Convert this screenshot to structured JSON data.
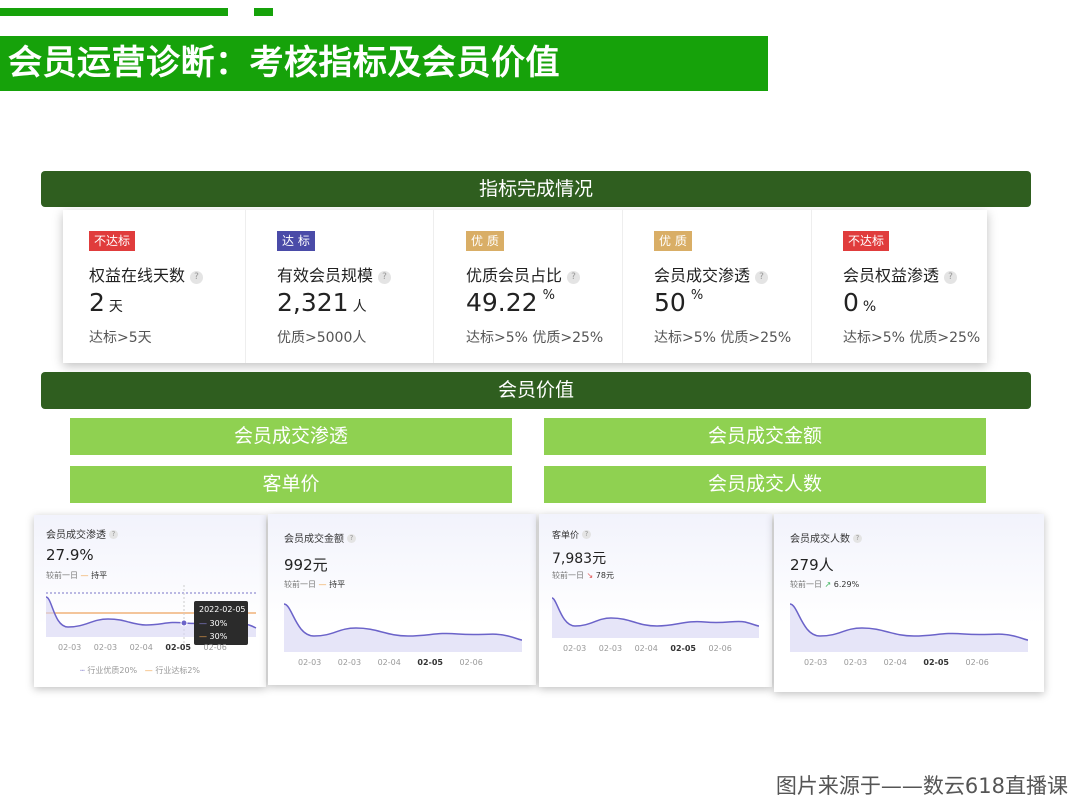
{
  "page_title": "会员运营诊断：考核指标及会员价值",
  "section_kpi": "指标完成情况",
  "section_value": "会员价值",
  "kpis": [
    {
      "badge": "不达标",
      "badge_color": "#e03c3c",
      "label": "权益在线天数",
      "help": "?",
      "value": "2",
      "unit": "天",
      "target": "达标>5天"
    },
    {
      "badge": "达 标",
      "badge_color": "#4a4ba8",
      "label": "有效会员规模",
      "help": "?",
      "value": "2,321",
      "unit": "人",
      "target": "优质>5000人"
    },
    {
      "badge": "优 质",
      "badge_color": "#d9ae66",
      "label": "优质会员占比",
      "help": "?",
      "value": "49.22",
      "unit": "%",
      "target": "达标>5% 优质>25%"
    },
    {
      "badge": "优 质",
      "badge_color": "#d9ae66",
      "label": "会员成交渗透",
      "help": "?",
      "value": "50",
      "unit": "%",
      "target": "达标>5% 优质>25%"
    },
    {
      "badge": "不达标",
      "badge_color": "#e03c3c",
      "label": "会员权益渗透",
      "help": "?",
      "value": "0",
      "unit": "%",
      "target": "达标>5% 优质>25%"
    }
  ],
  "value_boxes": [
    "会员成交渗透",
    "会员成交金额",
    "客单价",
    "会员成交人数"
  ],
  "mini_charts": [
    {
      "title": "会员成交渗透",
      "value": "27.9%",
      "compare_label": "较前一日",
      "compare_value": "持平",
      "x_labels": [
        "02-03",
        "02-03",
        "02-04",
        "02-05",
        "02-06"
      ],
      "tooltip": {
        "date": "2022-02-05",
        "line1": "30%",
        "line2": "30%"
      },
      "legend": [
        "行业优质20%",
        "行业达标2%"
      ]
    },
    {
      "title": "会员成交金额",
      "value": "992元",
      "compare_label": "较前一日",
      "compare_value": "持平",
      "x_labels": [
        "02-03",
        "02-03",
        "02-04",
        "02-05",
        "02-06"
      ]
    },
    {
      "title": "客单价",
      "value": "7,983元",
      "compare_label": "较前一日",
      "compare_value": "78元",
      "x_labels": [
        "02-03",
        "02-03",
        "02-04",
        "02-05",
        "02-06"
      ]
    },
    {
      "title": "会员成交人数",
      "value": "279人",
      "compare_label": "较前一日",
      "compare_value": "6.29%",
      "x_labels": [
        "02-03",
        "02-03",
        "02-04",
        "02-05",
        "02-06"
      ]
    }
  ],
  "source_note": "图片来源于——数云618直播课",
  "colors": {
    "brand_green": "#16a20a",
    "dark_green": "#2f5e1f",
    "light_green": "#8fd151",
    "line_purple": "#6b63c9"
  }
}
